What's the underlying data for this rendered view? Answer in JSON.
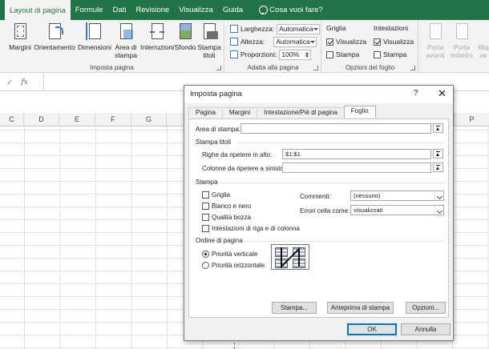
{
  "ribbon_tabs": [
    {
      "label": "Layout di pagina",
      "active": true
    },
    {
      "label": "Formule"
    },
    {
      "label": "Dati"
    },
    {
      "label": "Revisione"
    },
    {
      "label": "Visualizza"
    },
    {
      "label": "Guida"
    }
  ],
  "tell_me": "Cosa vuoi fare?",
  "ribbon": {
    "page_setup": {
      "group_label": "Imposta pagina",
      "margini": "Margini",
      "orientamento": "Orientamento",
      "dimensioni": "Dimensioni",
      "area_line1": "Area di",
      "area_line2": "stampa",
      "interruzioni": "Interruzioni",
      "sfondo": "Sfondo",
      "stampa_line1": "Stampa",
      "stampa_line2": "titoli"
    },
    "scale": {
      "group_label": "Adatta alla pagina",
      "larghezza_label": "Larghezza:",
      "larghezza_value": "Automatica",
      "altezza_label": "Altezza:",
      "altezza_value": "Automatica",
      "proporzioni_label": "Proporzioni:",
      "proporzioni_value": "100%"
    },
    "sheet_options": {
      "group_label": "Opzioni del foglio",
      "griglia": "Griglia",
      "intestazioni": "Intestazioni",
      "visualizza": "Visualizza",
      "stampa": "Stampa",
      "griglia_visualizza": true,
      "griglia_stampa": false,
      "intestazioni_visualizza": true,
      "intestazioni_stampa": false
    },
    "arrange": {
      "porta_avanti_1": "Porta",
      "porta_avanti_2": "avanti",
      "porta_indietro_1": "Porta",
      "porta_indietro_2": "indietro",
      "riq_1": "Riq",
      "riq_2": "se"
    }
  },
  "formula_bar": {
    "cancel": "✓",
    "fx": "fx"
  },
  "columns": [
    "C",
    "D",
    "E",
    "F",
    "G",
    "P"
  ],
  "dialog": {
    "title": "Imposta pagina",
    "help": "?",
    "close": "✕",
    "tabs": [
      "Pagina",
      "Margini",
      "Intestazione/Piè di pagina",
      "Foglio"
    ],
    "active_tab": "Foglio",
    "area_stampa_label": "Area di stampa:",
    "area_stampa_value": "",
    "stampa_titoli_header": "Stampa titoli",
    "righe_label": "Righe da ripetere in alto:",
    "righe_value": "$1:$1",
    "colonne_label": "Colonne da ripetere a sinistra:",
    "colonne_value": "",
    "stampa_header": "Stampa",
    "checkboxes": [
      {
        "label": "Griglia",
        "checked": false
      },
      {
        "label": "Bianco e nero",
        "checked": false
      },
      {
        "label": "Qualità bozza",
        "checked": false
      },
      {
        "label": "Intestazioni di riga e di colonna",
        "checked": false
      }
    ],
    "commenti_label": "Commenti:",
    "commenti_value": "(nessuno)",
    "errori_label": "Errori cella come:",
    "errori_value": "visualizzati",
    "ordine_header": "Ordine di pagina",
    "priorita_verticale": "Priorità verticale",
    "priorita_orizzontale": "Priorità orizzontale",
    "verticale_selected": true,
    "btn_stampa": "Stampa...",
    "btn_anteprima": "Anteprima di stampa",
    "btn_opzioni": "Opzioni...",
    "btn_ok": "OK",
    "btn_annulla": "Annulla"
  },
  "colors": {
    "excel_green": "#217346",
    "ribbon_bg": "#f3f3f3",
    "accent_blue": "#0078d7"
  }
}
